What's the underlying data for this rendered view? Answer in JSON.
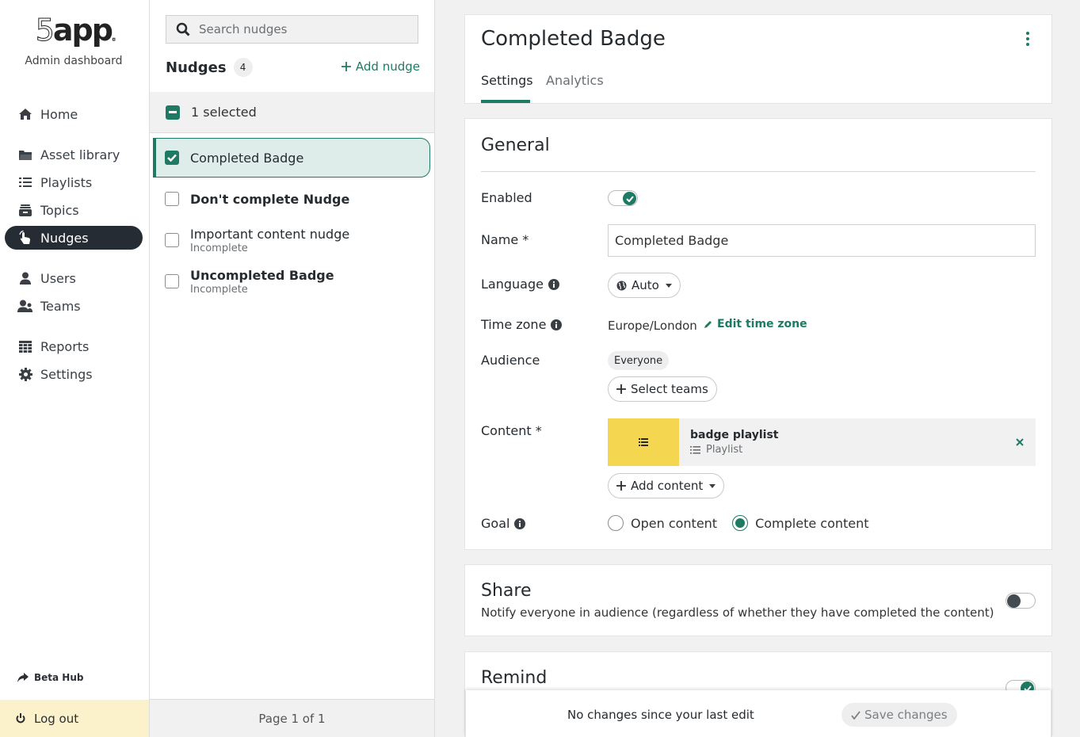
{
  "app": {
    "logo_main": "app",
    "logo_digit": "5",
    "logo_dot": "o",
    "subtitle": "Admin dashboard"
  },
  "sidebar": {
    "items": [
      {
        "label": "Home",
        "icon": "home-icon"
      },
      {
        "label": "Asset library",
        "icon": "folder-icon"
      },
      {
        "label": "Playlists",
        "icon": "list-icon"
      },
      {
        "label": "Topics",
        "icon": "archive-icon"
      },
      {
        "label": "Nudges",
        "icon": "pointer-hand-icon",
        "active": true
      },
      {
        "label": "Users",
        "icon": "user-icon"
      },
      {
        "label": "Teams",
        "icon": "users-icon"
      },
      {
        "label": "Reports",
        "icon": "table-icon"
      },
      {
        "label": "Settings",
        "icon": "gear-icon"
      }
    ],
    "beta_hub": "Beta Hub",
    "logout": "Log out"
  },
  "list": {
    "search_placeholder": "Search nudges",
    "title": "Nudges",
    "count": "4",
    "add_label": "Add nudge",
    "selected_text": "1 selected",
    "items": [
      {
        "name": "Completed Badge",
        "status": "",
        "checked": true,
        "bold": true
      },
      {
        "name": "Don't complete Nudge",
        "status": "",
        "checked": false,
        "bold": true
      },
      {
        "name": "Important content nudge",
        "status": "Incomplete",
        "checked": false,
        "bold": false
      },
      {
        "name": "Uncompleted Badge",
        "status": "Incomplete",
        "checked": false,
        "bold": true
      }
    ],
    "pagination": "Page 1 of 1"
  },
  "detail": {
    "title": "Completed Badge",
    "tabs": [
      {
        "label": "Settings",
        "active": true
      },
      {
        "label": "Analytics",
        "active": false
      }
    ],
    "general": {
      "title": "General",
      "enabled_label": "Enabled",
      "enabled": true,
      "name_label": "Name *",
      "name_value": "Completed Badge",
      "language_label": "Language",
      "language_value": "Auto",
      "timezone_label": "Time zone",
      "timezone_value": "Europe/London",
      "edit_timezone": "Edit time zone",
      "audience_label": "Audience",
      "audience_chip": "Everyone",
      "select_teams": "Select teams",
      "content_label": "Content *",
      "content_item": {
        "name": "badge playlist",
        "type": "Playlist"
      },
      "add_content": "Add content",
      "goal_label": "Goal",
      "goal_options": [
        {
          "label": "Open content",
          "selected": false
        },
        {
          "label": "Complete content",
          "selected": true
        }
      ]
    },
    "share": {
      "title": "Share",
      "description": "Notify everyone in audience (regardless of whether they have completed the content)",
      "enabled": false
    },
    "remind": {
      "title": "Remind",
      "enabled": true
    }
  },
  "savebar": {
    "status": "No changes since your last edit",
    "save_label": "Save changes"
  },
  "colors": {
    "accent": "#1f7a64",
    "nav_active_bg": "#262c33",
    "logout_bg": "#fbf1cb",
    "playlist_thumb": "#f5d651"
  }
}
